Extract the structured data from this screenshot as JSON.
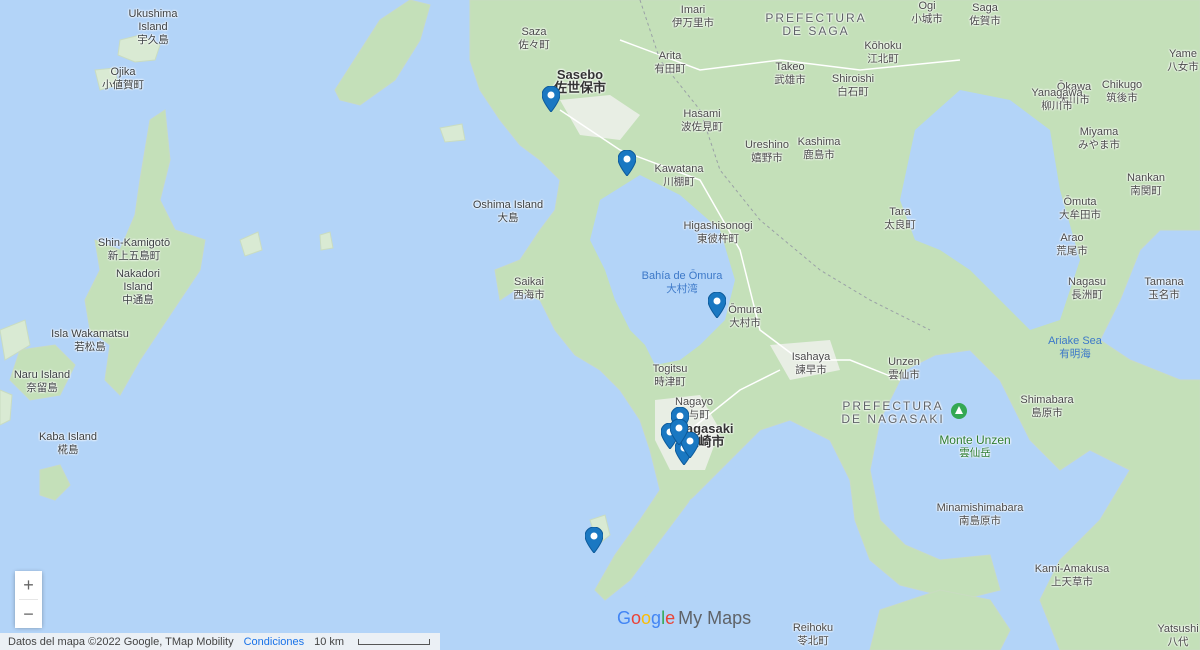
{
  "colors": {
    "water": "#b3d4f8",
    "land": "#d9ead3",
    "pin": "#1a78c2"
  },
  "labels": [
    {
      "id": "ukushima",
      "en": "Ukushima\nIsland",
      "jp": "宇久島"
    },
    {
      "id": "ojika",
      "en": "Ojika",
      "jp": "小値賀町"
    },
    {
      "id": "shinkamigoto",
      "en": "Shin-Kamigotō",
      "jp": "新上五島町"
    },
    {
      "id": "nakadori",
      "en": "Nakadori\nIsland",
      "jp": "中通島"
    },
    {
      "id": "wakamatsu",
      "en": "Isla Wakamatsu",
      "jp": "若松島"
    },
    {
      "id": "naru",
      "en": "Naru Island",
      "jp": "奈留島"
    },
    {
      "id": "kaba",
      "en": "Kaba Island",
      "jp": "椛島"
    },
    {
      "id": "saza",
      "en": "Saza",
      "jp": "佐々町"
    },
    {
      "id": "sasebo",
      "en": "Sasebo",
      "jp": "佐世保市"
    },
    {
      "id": "imari",
      "en": "Imari",
      "jp": "伊万里市"
    },
    {
      "id": "arita",
      "en": "Arita",
      "jp": "有田町"
    },
    {
      "id": "hasami",
      "en": "Hasami",
      "jp": "波佐見町"
    },
    {
      "id": "kawatana",
      "en": "Kawatana",
      "jp": "川棚町"
    },
    {
      "id": "ureshino",
      "en": "Ureshino",
      "jp": "嬉野市"
    },
    {
      "id": "takeo",
      "en": "Takeo",
      "jp": "武雄市"
    },
    {
      "id": "shiroishi",
      "en": "Shiroishi",
      "jp": "白石町"
    },
    {
      "id": "kohoku",
      "en": "Kōhoku",
      "jp": "江北町"
    },
    {
      "id": "ogi",
      "en": "Ogi",
      "jp": "小城市"
    },
    {
      "id": "saga",
      "en": "Saga",
      "jp": "佐賀市"
    },
    {
      "id": "kashima",
      "en": "Kashima",
      "jp": "鹿島市"
    },
    {
      "id": "oshima",
      "en": "Oshima Island",
      "jp": "大島"
    },
    {
      "id": "higashisonogi",
      "en": "Higashisonogi",
      "jp": "東彼杵町"
    },
    {
      "id": "tara",
      "en": "Tara",
      "jp": "太良町"
    },
    {
      "id": "saikai",
      "en": "Saikai",
      "jp": "西海市"
    },
    {
      "id": "omurabay",
      "en": "Bahía de Ōmura",
      "jp": "大村湾"
    },
    {
      "id": "omura",
      "en": "Ōmura",
      "jp": "大村市"
    },
    {
      "id": "isahaya",
      "en": "Isahaya",
      "jp": "諫早市"
    },
    {
      "id": "togitsu",
      "en": "Togitsu",
      "jp": "時津町"
    },
    {
      "id": "nagayo",
      "en": "Nagayo",
      "jp": "長与町"
    },
    {
      "id": "nagasaki",
      "en": "Nagasaki",
      "jp": "長崎市"
    },
    {
      "id": "unzen",
      "en": "Unzen",
      "jp": "雲仙市"
    },
    {
      "id": "montunzen",
      "en": "Monte Unzen",
      "jp": "雲仙岳"
    },
    {
      "id": "shimabara",
      "en": "Shimabara",
      "jp": "島原市"
    },
    {
      "id": "minamishimabara",
      "en": "Minamishimabara",
      "jp": "南島原市"
    },
    {
      "id": "kamiamakusa",
      "en": "Kami-Amakusa",
      "jp": "上天草市"
    },
    {
      "id": "reihoku",
      "en": "Reihoku",
      "jp": "苓北町"
    },
    {
      "id": "yatsushiro",
      "en": "Yatsushi",
      "jp": "八代"
    },
    {
      "id": "okawa",
      "en": "Ōkawa",
      "jp": "大川市"
    },
    {
      "id": "yanagawa",
      "en": "Yanagawa",
      "jp": "柳川市"
    },
    {
      "id": "chikugo",
      "en": "Chikugo",
      "jp": "筑後市"
    },
    {
      "id": "yame",
      "en": "Yame",
      "jp": "八女市"
    },
    {
      "id": "miyama",
      "en": "Miyama",
      "jp": "みやま市"
    },
    {
      "id": "nankan",
      "en": "Nankan",
      "jp": "南関町"
    },
    {
      "id": "omuta",
      "en": "Ōmuta",
      "jp": "大牟田市"
    },
    {
      "id": "arao",
      "en": "Arao",
      "jp": "荒尾市"
    },
    {
      "id": "tamana",
      "en": "Tamana",
      "jp": "玉名市"
    },
    {
      "id": "nagasu",
      "en": "Nagasu",
      "jp": "長洲町"
    },
    {
      "id": "ariake",
      "en": "Ariake Sea",
      "jp": "有明海"
    }
  ],
  "regions": {
    "saga": "PREFECTURA\nDE SAGA",
    "nagasaki": "PREFECTURA\nDE NAGASAKI"
  },
  "pins": [
    "pin-sasebo",
    "pin-kawatana",
    "pin-omura",
    "pin-nagasaki-1",
    "pin-nagasaki-2",
    "pin-nagasaki-3",
    "pin-nagasaki-4",
    "pin-nagasaki-5",
    "pin-coast"
  ],
  "zoom": {
    "in": "+",
    "out": "−"
  },
  "logo": {
    "g": [
      "G",
      "o",
      "o",
      "g",
      "l",
      "e"
    ],
    "product": "My Maps"
  },
  "attribution": {
    "data": "Datos del mapa ©2022 Google, TMap Mobility",
    "terms": "Condiciones",
    "scale": "10 km"
  }
}
